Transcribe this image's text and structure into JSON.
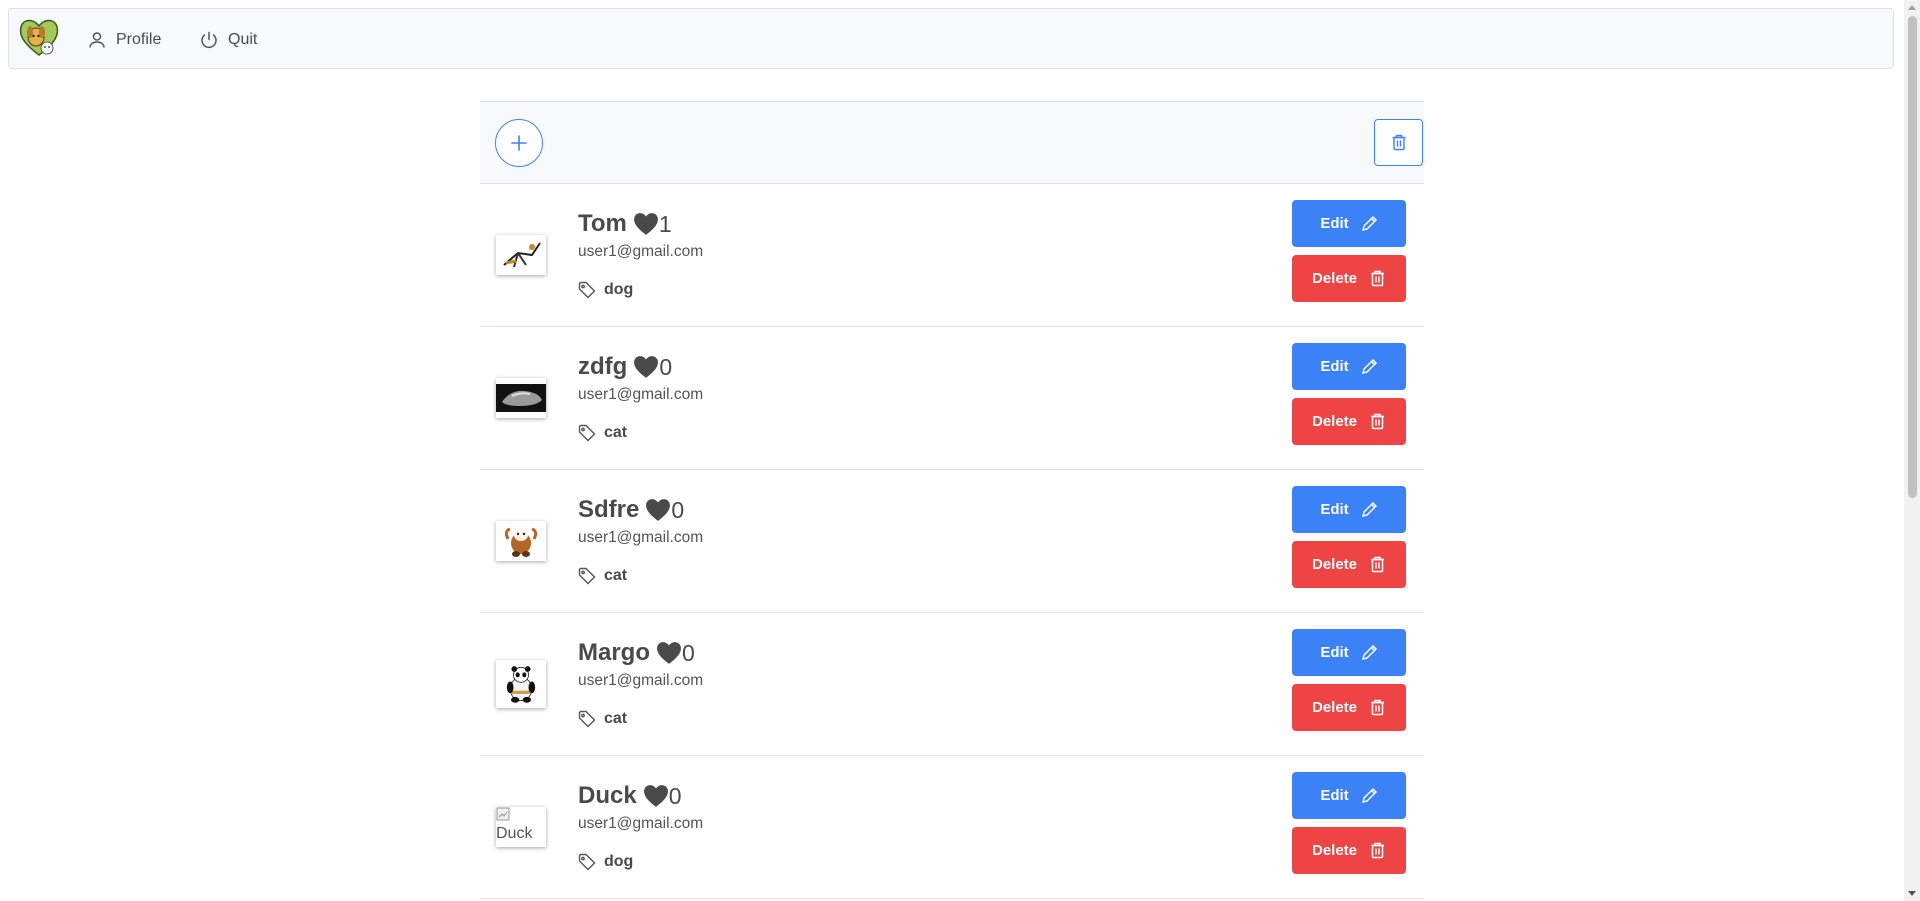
{
  "nav": {
    "logo_icon": "dog-cat-heart-logo",
    "profile_label": "Profile",
    "quit_label": "Quit"
  },
  "toolbar": {
    "add_icon": "plus-icon",
    "delete_all_icon": "trash-icon"
  },
  "pets": [
    {
      "name": "Tom",
      "likes": "1",
      "email": "user1@gmail.com",
      "tag": "dog",
      "image": "figure-pose"
    },
    {
      "name": "zdfg",
      "likes": "0",
      "email": "user1@gmail.com",
      "tag": "cat",
      "image": "car"
    },
    {
      "name": "Sdfre",
      "likes": "0",
      "email": "user1@gmail.com",
      "tag": "cat",
      "image": "red-panda"
    },
    {
      "name": "Margo",
      "likes": "0",
      "email": "user1@gmail.com",
      "tag": "cat",
      "image": "panda"
    },
    {
      "name": "Duck",
      "likes": "0",
      "email": "user1@gmail.com",
      "tag": "dog",
      "image": "broken",
      "image_alt": "Duck"
    }
  ],
  "buttons": {
    "edit_label": "Edit",
    "delete_label": "Delete"
  },
  "colors": {
    "edit": "#3b82f6",
    "delete": "#ef4444",
    "outline": "#3b82f6",
    "heart": "#4a4a4a"
  }
}
